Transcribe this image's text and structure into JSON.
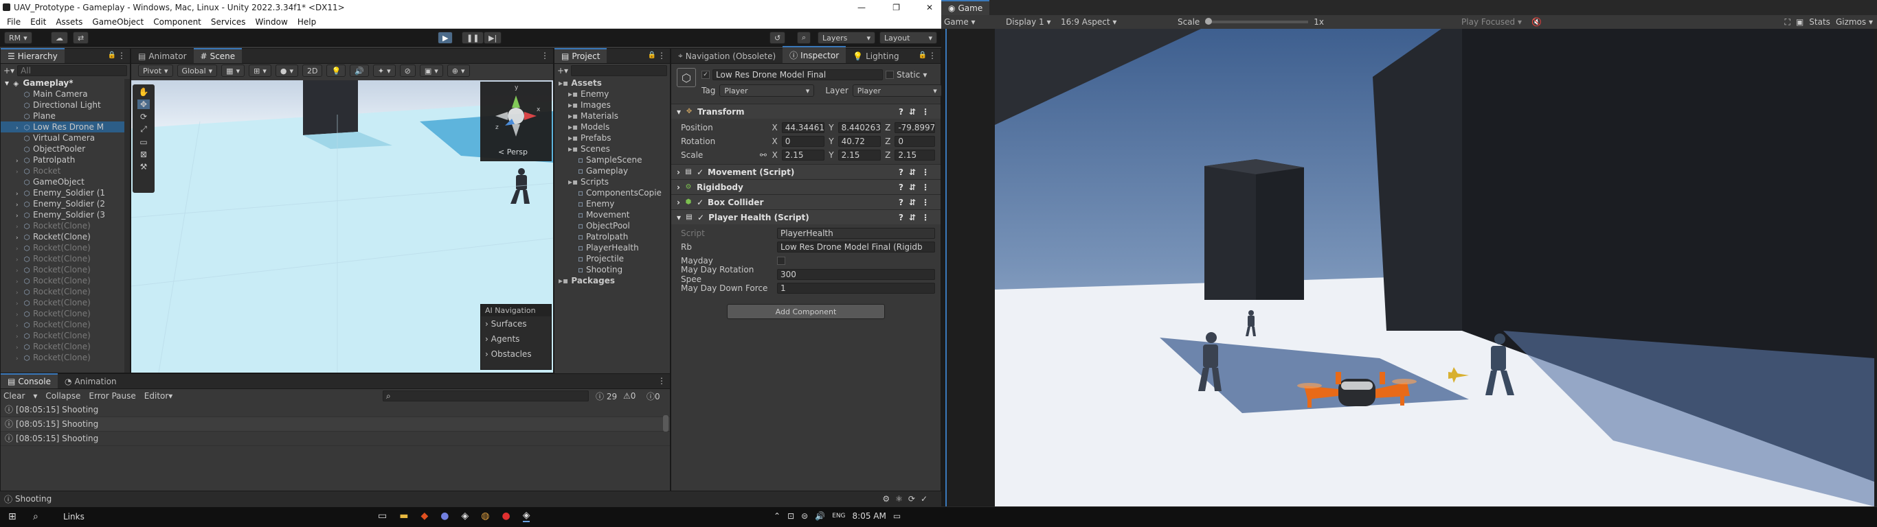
{
  "window": {
    "title": "UAV_Prototype - Gameplay - Windows, Mac, Linux - Unity 2022.3.34f1* <DX11>",
    "controls": [
      "—",
      "❐",
      "✕"
    ]
  },
  "menu": [
    "File",
    "Edit",
    "Assets",
    "GameObject",
    "Component",
    "Services",
    "Window",
    "Help"
  ],
  "toolbar": {
    "account": "RM",
    "layers": "Layers",
    "layout": "Layout"
  },
  "hierarchy": {
    "tab": "Hierarchy",
    "search_placeholder": "All",
    "scene": "Gameplay*",
    "items": [
      {
        "name": "Main Camera",
        "dim": false,
        "arrow": false
      },
      {
        "name": "Directional Light",
        "dim": false,
        "arrow": false
      },
      {
        "name": "Plane",
        "dim": false,
        "arrow": false
      },
      {
        "name": "Low Res Drone M",
        "dim": false,
        "arrow": true,
        "selected": true
      },
      {
        "name": "Virtual Camera",
        "dim": false,
        "arrow": false
      },
      {
        "name": "ObjectPooler",
        "dim": false,
        "arrow": false
      },
      {
        "name": "Patrolpath",
        "dim": false,
        "arrow": true
      },
      {
        "name": "Rocket",
        "dim": true,
        "arrow": true
      },
      {
        "name": "GameObject",
        "dim": false,
        "arrow": false
      },
      {
        "name": "Enemy_Soldier (1",
        "dim": false,
        "arrow": true
      },
      {
        "name": "Enemy_Soldier (2",
        "dim": false,
        "arrow": true
      },
      {
        "name": "Enemy_Soldier (3",
        "dim": false,
        "arrow": true
      },
      {
        "name": "Rocket(Clone)",
        "dim": true,
        "arrow": true
      },
      {
        "name": "Rocket(Clone)",
        "dim": false,
        "arrow": true
      },
      {
        "name": "Rocket(Clone)",
        "dim": true,
        "arrow": true
      },
      {
        "name": "Rocket(Clone)",
        "dim": true,
        "arrow": true
      },
      {
        "name": "Rocket(Clone)",
        "dim": true,
        "arrow": true
      },
      {
        "name": "Rocket(Clone)",
        "dim": true,
        "arrow": true
      },
      {
        "name": "Rocket(Clone)",
        "dim": true,
        "arrow": true
      },
      {
        "name": "Rocket(Clone)",
        "dim": true,
        "arrow": true
      },
      {
        "name": "Rocket(Clone)",
        "dim": true,
        "arrow": true
      },
      {
        "name": "Rocket(Clone)",
        "dim": true,
        "arrow": true
      },
      {
        "name": "Rocket(Clone)",
        "dim": true,
        "arrow": true
      },
      {
        "name": "Rocket(Clone)",
        "dim": true,
        "arrow": true
      },
      {
        "name": "Rocket(Clone)",
        "dim": true,
        "arrow": true
      }
    ]
  },
  "scene_view": {
    "tabs": [
      "Animator",
      "Scene"
    ],
    "pivot": "Pivot",
    "global": "Global",
    "mode_2d": "2D",
    "gizmo_label": "< Persp",
    "axis_labels": [
      "y",
      "x",
      "z"
    ],
    "ai_nav": {
      "title": "AI Navigation",
      "items": [
        "Surfaces",
        "Agents",
        "Obstacles"
      ]
    }
  },
  "project": {
    "tab": "Project",
    "items": [
      {
        "label": "Assets",
        "level": 0,
        "bold": true
      },
      {
        "label": "Enemy",
        "level": 1
      },
      {
        "label": "Images",
        "level": 1
      },
      {
        "label": "Materials",
        "level": 1
      },
      {
        "label": "Models",
        "level": 1
      },
      {
        "label": "Prefabs",
        "level": 1
      },
      {
        "label": "Scenes",
        "level": 1
      },
      {
        "label": "SampleScene",
        "level": 2
      },
      {
        "label": "Gameplay",
        "level": 2
      },
      {
        "label": "Scripts",
        "level": 1
      },
      {
        "label": "ComponentsCopie",
        "level": 2
      },
      {
        "label": "Enemy",
        "level": 2
      },
      {
        "label": "Movement",
        "level": 2
      },
      {
        "label": "ObjectPool",
        "level": 2
      },
      {
        "label": "Patrolpath",
        "level": 2
      },
      {
        "label": "PlayerHealth",
        "level": 2
      },
      {
        "label": "Projectile",
        "level": 2
      },
      {
        "label": "Shooting",
        "level": 2
      },
      {
        "label": "Packages",
        "level": 0,
        "bold": true
      }
    ]
  },
  "inspector": {
    "tabs": [
      "Navigation (Obsolete)",
      "Inspector",
      "Lighting"
    ],
    "object_name": "Low Res Drone Model Final",
    "static_label": "Static",
    "tag_label": "Tag",
    "tag_value": "Player",
    "layer_label": "Layer",
    "layer_value": "Player",
    "transform": {
      "title": "Transform",
      "position": {
        "label": "Position",
        "x": "44.34461",
        "y": "8.440263",
        "z": "-79.8997:"
      },
      "rotation": {
        "label": "Rotation",
        "x": "0",
        "y": "40.72",
        "z": "0"
      },
      "scale": {
        "label": "Scale",
        "x": "2.15",
        "y": "2.15",
        "z": "2.15"
      }
    },
    "components": [
      "Movement (Script)",
      "Rigidbody",
      "Box Collider",
      "Player Health (Script)"
    ],
    "player_health": {
      "script_label": "Script",
      "script_value": "PlayerHealth",
      "rb_label": "Rb",
      "rb_value": "Low Res Drone Model Final (Rigidb",
      "mayday_label": "Mayday",
      "rot_label": "May Day Rotation Spee",
      "rot_value": "300",
      "down_label": "May Day Down Force",
      "down_value": "1"
    },
    "add_component": "Add Component"
  },
  "console": {
    "tabs": [
      "Console",
      "Animation"
    ],
    "buttons": [
      "Clear",
      "Collapse",
      "Error Pause",
      "Editor"
    ],
    "counts": {
      "info": "29",
      "warn": "0",
      "error": "0"
    },
    "rows": [
      "[08:05:15] Shooting",
      "[08:05:15] Shooting",
      "[08:05:15] Shooting"
    ],
    "status": "Shooting"
  },
  "game_view": {
    "tab": "Game",
    "mode": "Game",
    "display": "Display 1",
    "aspect": "16:9 Aspect",
    "scale_label": "Scale",
    "scale_value": "1x",
    "play_focused": "Play Focused",
    "stats": "Stats",
    "gizmos": "Gizmos"
  },
  "taskbar": {
    "links": "Links",
    "time": "8:05 AM",
    "lang": "ENG"
  },
  "colors": {
    "accent": "#3a79bb",
    "selection": "#2c5d87",
    "sky": "#4a6a9a",
    "ground": "#f2f4f8"
  }
}
